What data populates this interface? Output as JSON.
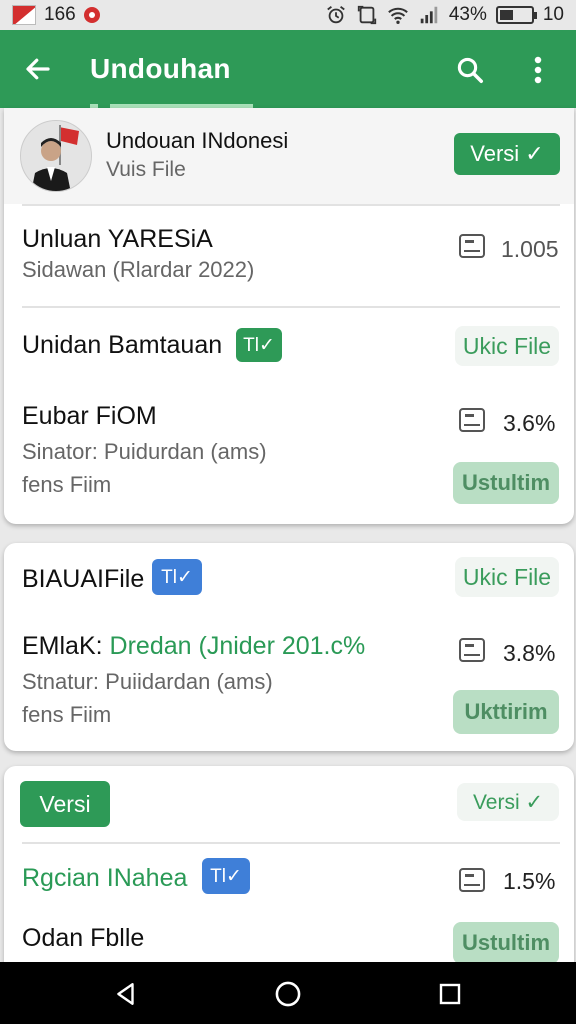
{
  "status_bar": {
    "left_number": "166",
    "battery_text": "43%",
    "battery_level": 0.43,
    "time": "10",
    "icons": [
      "flag-icon",
      "record-icon",
      "alarm-icon",
      "screenshot-icon",
      "wifi-icon",
      "signal-icon",
      "battery-icon"
    ]
  },
  "app_bar": {
    "title": "Undouhan",
    "icons": [
      "back-arrow-icon",
      "search-icon",
      "more-vert-icon"
    ]
  },
  "card1": {
    "header": {
      "title": "Undouan INdonesi",
      "subtitle": "Vuis File",
      "button": "Versi ✓"
    },
    "row1": {
      "title": "Unluan YARESiA",
      "subtitle": "Sidawan (Rlardar 2022)",
      "value": "1.005"
    },
    "row2": {
      "title": "Unidan Bamtauan",
      "badge": "Tl✓",
      "button": "Ukic File"
    },
    "row3": {
      "title": "Eubar FiOM",
      "line1": "Sinator: Puidurdan (ams)",
      "line2": "fens Fiim",
      "value": "3.6%",
      "button": "Ustultim"
    }
  },
  "card2": {
    "row1": {
      "title": "BIAUAIFile",
      "badge": "Tl✓",
      "button": "Ukic File"
    },
    "row2": {
      "title_prefix": "EMlaK:",
      "title_green": "Dredan (Jnider 201.c%",
      "line1": "Stnatur: Puiidardan (ams)",
      "line2": "fens Fiim",
      "value": "3.8%",
      "button": "Ukttirim"
    }
  },
  "card3": {
    "header": {
      "button_solid": "Versi",
      "button_ghost": "Versi ✓"
    },
    "row1": {
      "title": "Rgcian INahea",
      "badge": "Tl✓",
      "value": "1.5%"
    },
    "row2": {
      "title": "Odan Fblle",
      "button": "Ustultim"
    }
  },
  "colors": {
    "primary": "#2e9a57",
    "badge_blue": "#3f7fd8",
    "pale_button": "#b9dec4"
  }
}
